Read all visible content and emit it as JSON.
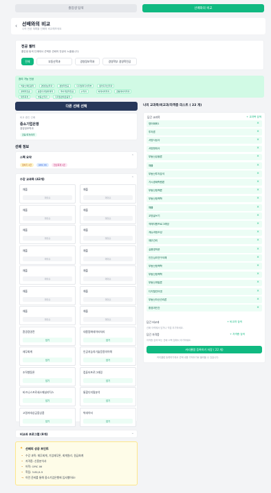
{
  "tabs": {
    "left": "졸업생 탐색",
    "right": "선배와의 비교"
  },
  "header": {
    "back": "‹",
    "title": "선배와의 비교",
    "subtitle": "나의 전공 계획을 선배와 비교해보세요"
  },
  "major_select": {
    "title": "전공 필터",
    "desc": "졸업생 탐색 단계에서 선택한 선배의 전공이 노출됩니다.",
    "options": [
      "전체",
      "부동산학과",
      "경영정보학과",
      "경영학부 경영학전공"
    ],
    "selected": "전체"
  },
  "subjects_box": {
    "label": "참여 가능 전공",
    "chips": [
      "역량스펙트럼학",
      "경영정보학과",
      "경영학전공",
      "디지털미디어학부",
      "컬러디자인학과",
      "경제학전공",
      "융합디지털회계학",
      "국어국문학전공",
      "수학과",
      "빅데이터학과",
      "금융데이터학과",
      "재무회계",
      "부동산학과",
      "디지털경제금융학"
    ]
  },
  "left": {
    "select_button": "다른 선배 선택",
    "senior_card": {
      "label": "비교 중인 선배",
      "company": "중소기업은행",
      "major": "경영정보학과",
      "tag": "금융/회계/재무"
    },
    "section_title": "선배 정보",
    "spec": {
      "title": "스펙 요약",
      "tags": [
        "정처기 2급",
        "OPIC IM",
        "전산회계 1급"
      ]
    },
    "course_title": "수강 교과목 (42개)",
    "courses": [
      {
        "name": "채플",
        "status": "미이수"
      },
      {
        "name": "채플",
        "status": "미이수"
      },
      {
        "name": "채플",
        "status": "미이수"
      },
      {
        "name": "채플",
        "status": "미이수"
      },
      {
        "name": "채플",
        "status": "미이수"
      },
      {
        "name": "채플",
        "status": "미이수"
      },
      {
        "name": "채플",
        "status": "미이수"
      },
      {
        "name": "채플",
        "status": "미이수"
      },
      {
        "name": "채플",
        "status": "미이수"
      },
      {
        "name": "채플",
        "status": "미이수"
      },
      {
        "name": "채플",
        "status": "미이수"
      },
      {
        "name": "채플",
        "status": "미이수"
      },
      {
        "name": "채플",
        "status": "미이수"
      },
      {
        "name": "채플",
        "status": "미이수"
      },
      {
        "name": "환경경영전",
        "status": "담기"
      },
      {
        "name": "대용량화데이터처리",
        "status": "담기"
      },
      {
        "name": "재무회계",
        "status": "담기"
      },
      {
        "name": "인공지능의기술응용의이해",
        "status": "담기"
      },
      {
        "name": "조직행동론",
        "status": "담기"
      },
      {
        "name": "컴퓨터프로그래밍",
        "status": "담기"
      },
      {
        "name": "비즈니스프로세스매널리틱스",
        "status": "담기"
      },
      {
        "name": "통합디지털분석",
        "status": "담기"
      },
      {
        "name": "고령자대상금융상품",
        "status": "담기"
      },
      {
        "name": "빅데이터",
        "status": "담기"
      }
    ],
    "extra_title": "비교과 프로그램 (8개)",
    "tips": {
      "title": "선배의 성공 포인트",
      "items": [
        "수강 과목: 재무회계, 기업재무론, 회계원리, 원금회계",
        "자격증: 신용분석사",
        "어학: OPIC IM",
        "학점: 3.81/4.5",
        "이런 준비를 통해 중소기업은행에 입사했어요!"
      ]
    }
  },
  "right": {
    "title": "나의 교과목/비교과/자격증 리스트 ( 22 개)",
    "course_label": "담긴 교과목",
    "course_add": "+ 교과목 검색",
    "courses": [
      "영어회화1",
      "투자론",
      "서양사상사",
      "서양현대사",
      "부동산금융론",
      "채플",
      "부동산투자분석",
      "가시경제학원론",
      "부동산정책론",
      "부동산정책학",
      "채플",
      "교양글쓰기",
      "객체지향프로그래밍",
      "게슈과정조성",
      "재무관리",
      "실용영작문",
      "인간심리연구이해",
      "부동산정책학",
      "부동산정책학",
      "부동산개발론",
      "디지털인터넷",
      "부동산자산관리론",
      "환경과인간"
    ],
    "extra_label": "담긴 비교과",
    "extra_add": "+ 비교과 검색",
    "extra_empty": "선배 이력에서 담거나 직접 추가하세요.",
    "cert_label": "담긴 자격증",
    "cert_add": "+ 자격증 검색",
    "cert_empty": "자격증 검색 또는 선배 스펙 칩에서 추가하세요.",
    "button": "커리큘럼 등록하기 저장 ( 22 개)",
    "footnote": "커리큘럼 등록하기에서 선택 내용 가져오기로 불러올 수 있습니다."
  }
}
